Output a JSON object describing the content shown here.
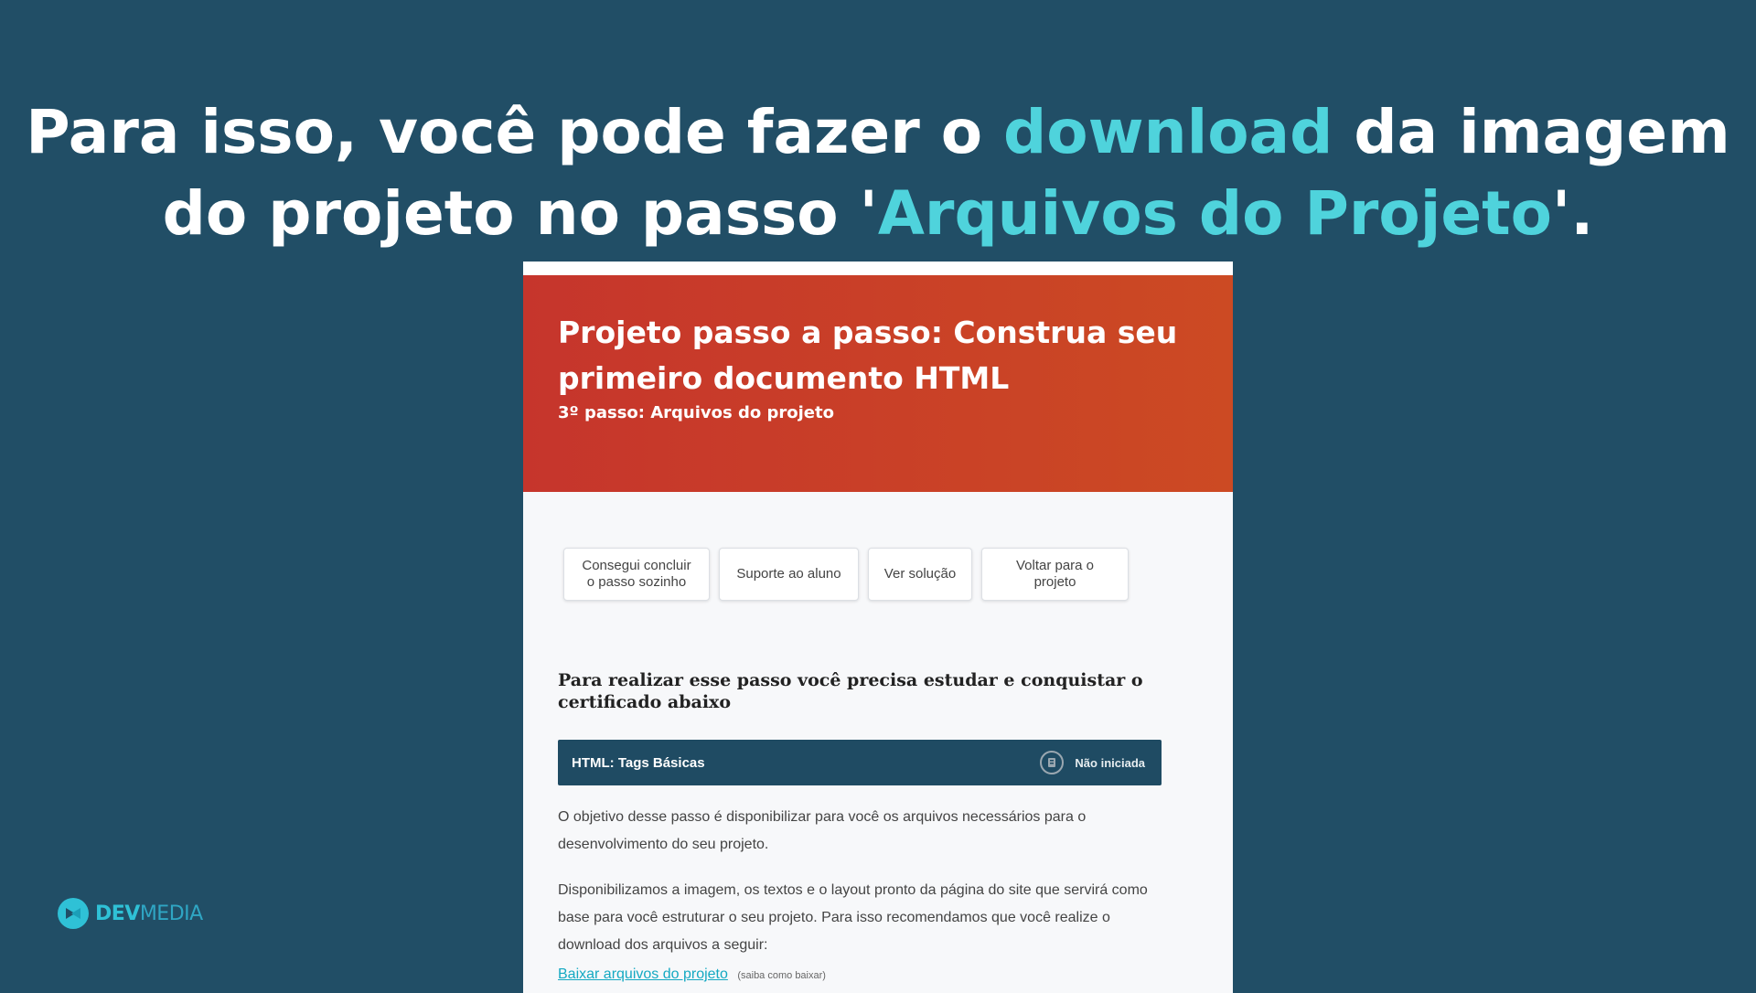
{
  "headline": {
    "line1_pre": "Para isso, você pode fazer o ",
    "line1_highlight": "download",
    "line1_post": " da imagem",
    "line2_pre": "do projeto no passo '",
    "line2_highlight": "Arquivos do Projeto",
    "line2_post": "'."
  },
  "banner": {
    "title": "Projeto passo a passo: Construa seu primeiro documento HTML",
    "subtitle": "3º passo: Arquivos do projeto"
  },
  "actions": [
    {
      "label": "Consegui concluir o passo sozinho"
    },
    {
      "label": "Suporte ao aluno"
    },
    {
      "label": "Ver solução"
    },
    {
      "label": "Voltar para o projeto"
    }
  ],
  "requirement": {
    "heading": "Para realizar esse passo você precisa estudar e conquistar o certificado abaixo",
    "certificate_name": "HTML: Tags Básicas",
    "certificate_status": "Não iniciada",
    "certificate_icon": "badge-icon"
  },
  "content": {
    "paragraph1": "O objetivo desse passo é disponibilizar para você os arquivos necessários para o desenvolvimento do seu projeto.",
    "paragraph2": "Disponibilizamos a imagem, os textos e o layout pronto da página do site que servirá como base para você estruturar o seu projeto. Para isso recomendamos que você realize o download dos arquivos a seguir:",
    "download_link": "Baixar arquivos do projeto",
    "download_help": "(saiba como baixar)"
  },
  "logo": {
    "dev": "DEV",
    "media": "MEDIA"
  },
  "colors": {
    "background": "#214e66",
    "highlight": "#4fd3dc",
    "banner_start": "#c6352c",
    "banner_end": "#cc4a23",
    "cert_bar": "#1f4b63",
    "link": "#14a9c2"
  }
}
